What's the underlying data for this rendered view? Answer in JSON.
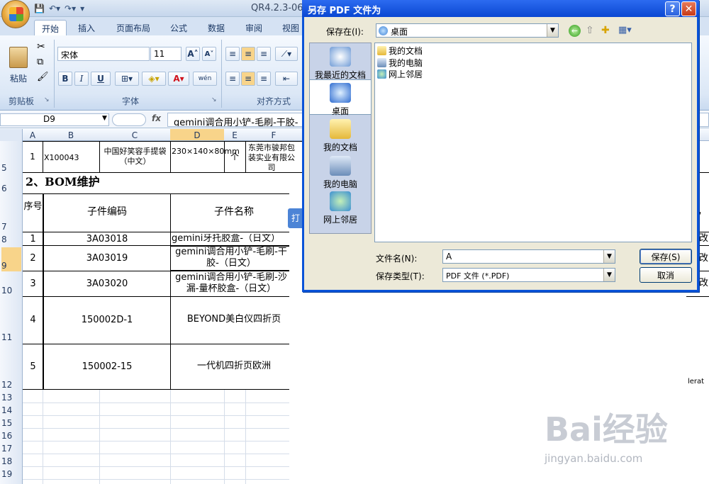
{
  "window": {
    "title": "QR4.2.3-06",
    "qat_items": [
      "save-icon",
      "undo-icon",
      "redo-icon",
      "customize-icon"
    ]
  },
  "ribbon": {
    "tabs": [
      "开始",
      "插入",
      "页面布局",
      "公式",
      "数据",
      "审阅",
      "视图"
    ],
    "active_tab": "开始",
    "clipboard": {
      "paste_label": "粘贴",
      "group_label": "剪贴板"
    },
    "font": {
      "name": "宋体",
      "size": "11",
      "group_label": "字体",
      "bold": "B",
      "italic": "I",
      "underline": "U",
      "wen": "wén"
    },
    "align": {
      "group_label": "对齐方式"
    }
  },
  "formula_bar": {
    "cell_ref": "D9",
    "fx": "fx",
    "content": "gemini调合用小铲-毛刷-干胶-（日文）"
  },
  "sheet": {
    "columns": [
      "A",
      "B",
      "C",
      "D",
      "E",
      "F"
    ],
    "rows": [
      "5",
      "6",
      "7",
      "8",
      "9",
      "10",
      "11",
      "12",
      "13",
      "14",
      "15",
      "16",
      "17",
      "18",
      "19"
    ],
    "row5": {
      "a": "1",
      "b": "X100043",
      "c": "中国好笑容手提袋（中文）",
      "d": "230×140×80mm",
      "e": "个",
      "f": "东莞市骏邦包装实业有限公司"
    },
    "section_title": "2、BOM维护",
    "headers": {
      "seq": "序号",
      "code": "子件编码",
      "name": "子件名称"
    },
    "items": [
      {
        "seq": "1",
        "code": "3A03018",
        "name": "gemini牙托胶盒-（日文）"
      },
      {
        "seq": "2",
        "code": "3A03019",
        "name": "gemini调合用小铲-毛刷-干胶-（日文）"
      },
      {
        "seq": "3",
        "code": "3A03020",
        "name": "gemini调合用小铲-毛刷-沙漏-量杯胶盒-（日文）"
      },
      {
        "seq": "4",
        "code": "150002D-1",
        "name": "BEYOND美白仪四折页"
      },
      {
        "seq": "5",
        "code": "150002-15",
        "name": "一代机四折页欧洲"
      }
    ],
    "partial_right": {
      "r7": "，",
      "r8": "改",
      "r9": "改",
      "r10": "改",
      "r12": "lerat"
    },
    "behind_dialog_tab": "打"
  },
  "dialog": {
    "title": "另存 PDF 文件为",
    "save_in_label": "保存在(I):",
    "save_in_value": "桌面",
    "places": [
      "我最近的文档",
      "桌面",
      "我的文档",
      "我的电脑",
      "网上邻居"
    ],
    "files": [
      "我的文档",
      "我的电脑",
      "网上邻居"
    ],
    "filename_label": "文件名(N):",
    "filename_value": "A",
    "filetype_label": "保存类型(T):",
    "filetype_value": "PDF 文件 (*.PDF)",
    "save_button": "保存(S)",
    "cancel_button": "取消"
  },
  "watermark": {
    "brand": "Bai经验",
    "url": "jingyan.baidu.com"
  }
}
